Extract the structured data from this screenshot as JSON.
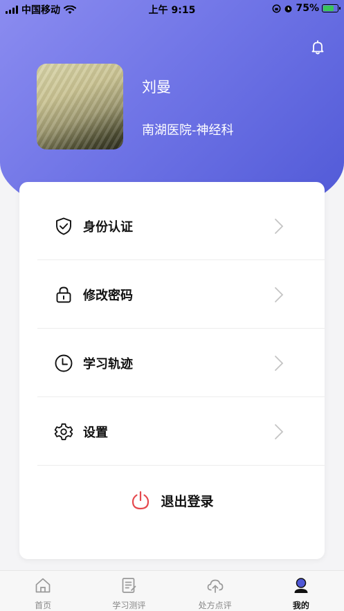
{
  "status_bar": {
    "carrier": "中国移动",
    "time": "上午 9:15",
    "battery": "75%"
  },
  "profile": {
    "name": "刘曼",
    "organization": "南湖医院-神经科"
  },
  "menu": {
    "items": [
      {
        "label": "身份认证",
        "icon": "shield-check-icon"
      },
      {
        "label": "修改密码",
        "icon": "lock-icon"
      },
      {
        "label": "学习轨迹",
        "icon": "clock-icon"
      },
      {
        "label": "设置",
        "icon": "gear-icon"
      }
    ],
    "logout_label": "退出登录"
  },
  "tabbar": {
    "tabs": [
      {
        "label": "首页",
        "icon": "home-icon"
      },
      {
        "label": "学习测评",
        "icon": "document-edit-icon"
      },
      {
        "label": "处方点评",
        "icon": "cloud-upload-icon"
      },
      {
        "label": "我的",
        "icon": "user-icon"
      }
    ],
    "active": "我的"
  },
  "colors": {
    "header_start": "#8b8cf0",
    "header_end": "#4f58d6",
    "logout_icon": "#e5484d",
    "active_tab_icon": "#4f58d6"
  }
}
